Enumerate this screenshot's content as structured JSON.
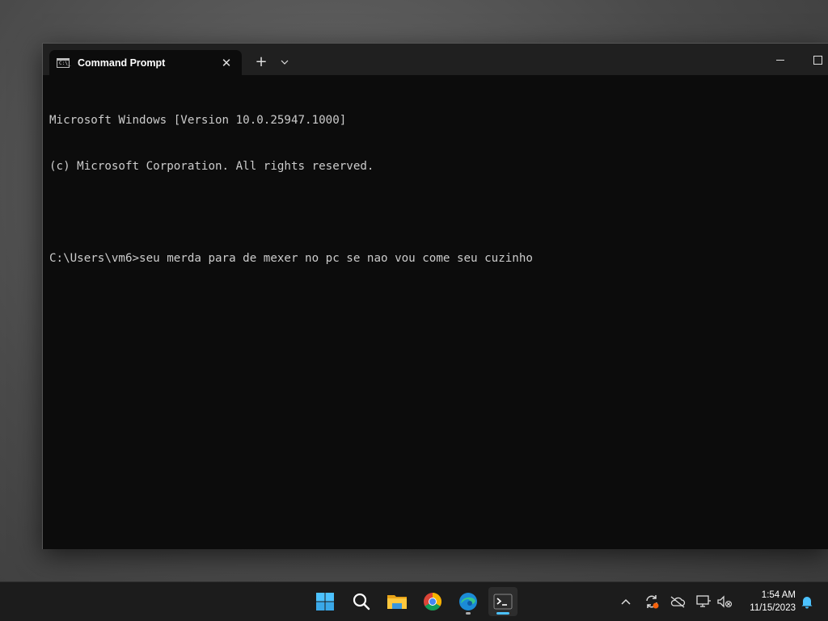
{
  "window": {
    "tab_title": "Command Prompt",
    "tab_icon_text": "C:\\_",
    "new_tab_label": "+",
    "close_tab_label": "✕"
  },
  "console": {
    "lines": [
      "Microsoft Windows [Version 10.0.25947.1000]",
      "(c) Microsoft Corporation. All rights reserved.",
      "",
      "C:\\Users\\vm6>seu merda para de mexer no pc se nao vou come seu cuzinho"
    ]
  },
  "taskbar": {
    "apps": [
      {
        "name": "start-icon"
      },
      {
        "name": "search-icon"
      },
      {
        "name": "file-explorer-icon"
      },
      {
        "name": "chrome-icon"
      },
      {
        "name": "edge-icon"
      },
      {
        "name": "terminal-icon",
        "active": true
      }
    ],
    "tray_icons": [
      "chevron-up-icon",
      "sync-icon",
      "cloud-off-icon",
      "network-icon",
      "volume-muted-icon"
    ],
    "time": "1:54 AM",
    "date": "11/15/2023"
  },
  "colors": {
    "console_bg": "#0c0c0c",
    "console_fg": "#cccccc",
    "titlebar_bg": "#202020",
    "taskbar_bg": "#1c1c1c",
    "accent": "#4cc2ff"
  }
}
